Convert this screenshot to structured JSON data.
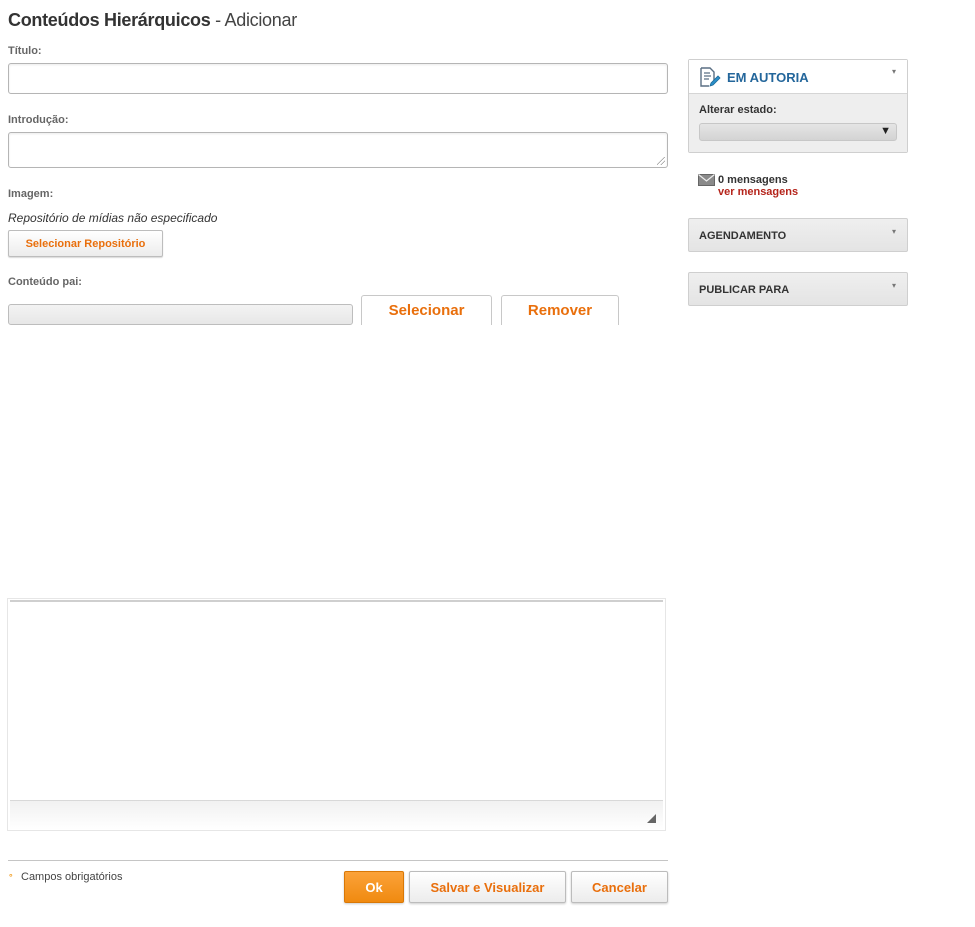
{
  "header": {
    "title_main": "Conteúdos Hierárquicos",
    "title_separator": " - ",
    "title_action": "Adicionar"
  },
  "form": {
    "titulo_label": "Título:",
    "titulo_value": "",
    "introducao_label": "Introdução:",
    "introducao_value": "",
    "imagem_label": "Imagem:",
    "repo_note": "Repositório de mídias não especificado",
    "select_repo_button": "Selecionar Repositório",
    "parent_label": "Conteúdo pai:",
    "parent_value": "",
    "select_button": "Selecionar",
    "remove_button": "Remover"
  },
  "footer": {
    "required_mark": "°",
    "required_text": "Campos obrigatórios",
    "ok_button": "Ok",
    "save_preview_button": "Salvar e Visualizar",
    "cancel_button": "Cancelar"
  },
  "sidebar": {
    "status_panel": {
      "title": "EM AUTORIA",
      "change_state_label": "Alterar estado:",
      "state_value": "",
      "caret": "▾"
    },
    "messages": {
      "count_text": "0 mensagens",
      "link_text": "ver mensagens"
    },
    "schedule_panel": {
      "title": "AGENDAMENTO",
      "caret": "▾"
    },
    "publish_panel": {
      "title": "PUBLICAR PARA",
      "caret": "▾"
    }
  },
  "colors": {
    "accent_orange": "#e96f0c",
    "ok_button": "#f08a10",
    "panel_title_blue": "#23669b",
    "link_red": "#b5241b"
  },
  "icons": [
    "edit-document-icon",
    "envelope-icon",
    "chevron-down-icon",
    "resize-handle-icon"
  ]
}
